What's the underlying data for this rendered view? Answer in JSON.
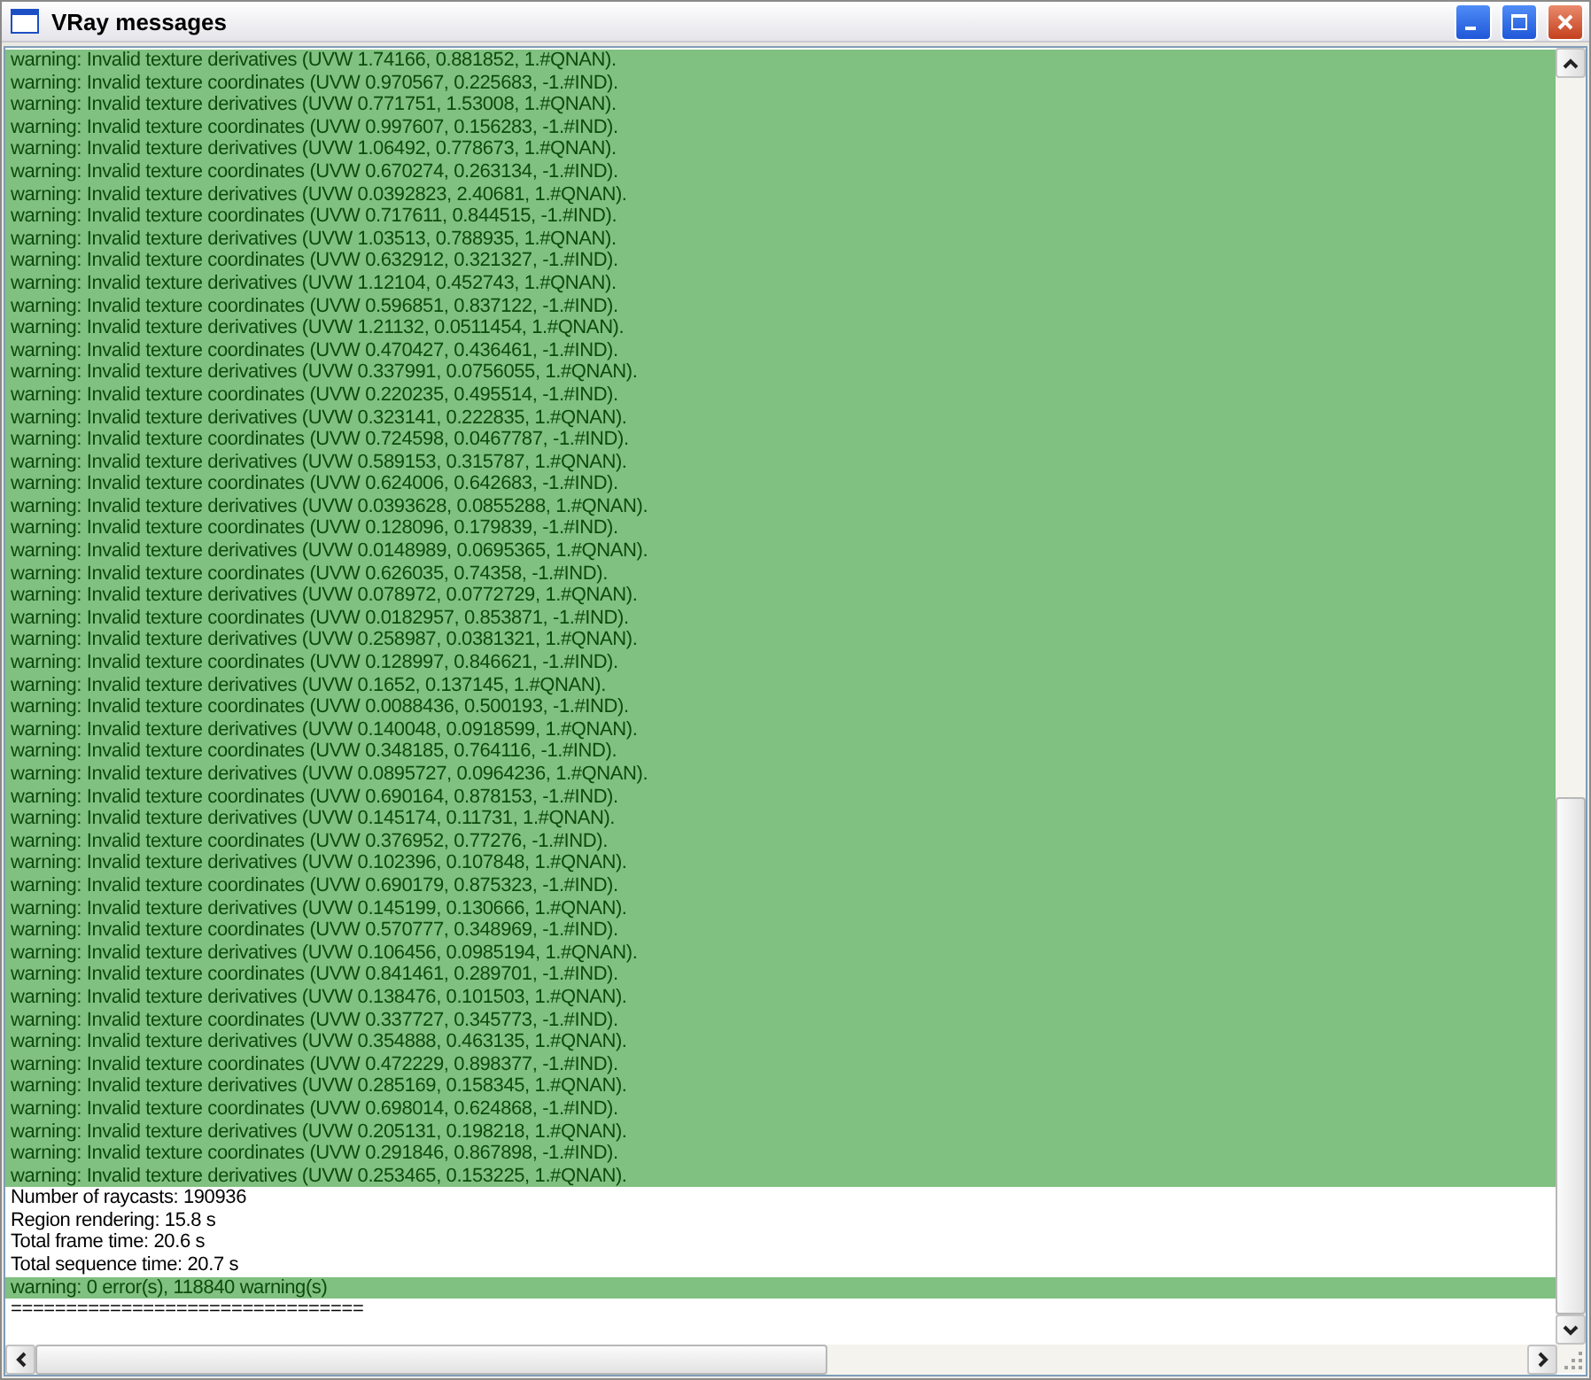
{
  "window": {
    "title": "VRay messages"
  },
  "messages": [
    {
      "kind": "warning",
      "text": "warning: Invalid texture derivatives (UVW 1.74166, 0.881852, 1.#QNAN)."
    },
    {
      "kind": "warning",
      "text": "warning: Invalid texture coordinates (UVW 0.970567, 0.225683, -1.#IND)."
    },
    {
      "kind": "warning",
      "text": "warning: Invalid texture derivatives (UVW 0.771751, 1.53008, 1.#QNAN)."
    },
    {
      "kind": "warning",
      "text": "warning: Invalid texture coordinates (UVW 0.997607, 0.156283, -1.#IND)."
    },
    {
      "kind": "warning",
      "text": "warning: Invalid texture derivatives (UVW 1.06492, 0.778673, 1.#QNAN)."
    },
    {
      "kind": "warning",
      "text": "warning: Invalid texture coordinates (UVW 0.670274, 0.263134, -1.#IND)."
    },
    {
      "kind": "warning",
      "text": "warning: Invalid texture derivatives (UVW 0.0392823, 2.40681, 1.#QNAN)."
    },
    {
      "kind": "warning",
      "text": "warning: Invalid texture coordinates (UVW 0.717611, 0.844515, -1.#IND)."
    },
    {
      "kind": "warning",
      "text": "warning: Invalid texture derivatives (UVW 1.03513, 0.788935, 1.#QNAN)."
    },
    {
      "kind": "warning",
      "text": "warning: Invalid texture coordinates (UVW 0.632912, 0.321327, -1.#IND)."
    },
    {
      "kind": "warning",
      "text": "warning: Invalid texture derivatives (UVW 1.12104, 0.452743, 1.#QNAN)."
    },
    {
      "kind": "warning",
      "text": "warning: Invalid texture coordinates (UVW 0.596851, 0.837122, -1.#IND)."
    },
    {
      "kind": "warning",
      "text": "warning: Invalid texture derivatives (UVW 1.21132, 0.0511454, 1.#QNAN)."
    },
    {
      "kind": "warning",
      "text": "warning: Invalid texture coordinates (UVW 0.470427, 0.436461, -1.#IND)."
    },
    {
      "kind": "warning",
      "text": "warning: Invalid texture derivatives (UVW 0.337991, 0.0756055, 1.#QNAN)."
    },
    {
      "kind": "warning",
      "text": "warning: Invalid texture coordinates (UVW 0.220235, 0.495514, -1.#IND)."
    },
    {
      "kind": "warning",
      "text": "warning: Invalid texture derivatives (UVW 0.323141, 0.222835, 1.#QNAN)."
    },
    {
      "kind": "warning",
      "text": "warning: Invalid texture coordinates (UVW 0.724598, 0.0467787, -1.#IND)."
    },
    {
      "kind": "warning",
      "text": "warning: Invalid texture derivatives (UVW 0.589153, 0.315787, 1.#QNAN)."
    },
    {
      "kind": "warning",
      "text": "warning: Invalid texture coordinates (UVW 0.624006, 0.642683, -1.#IND)."
    },
    {
      "kind": "warning",
      "text": "warning: Invalid texture derivatives (UVW 0.0393628, 0.0855288, 1.#QNAN)."
    },
    {
      "kind": "warning",
      "text": "warning: Invalid texture coordinates (UVW 0.128096, 0.179839, -1.#IND)."
    },
    {
      "kind": "warning",
      "text": "warning: Invalid texture derivatives (UVW 0.0148989, 0.0695365, 1.#QNAN)."
    },
    {
      "kind": "warning",
      "text": "warning: Invalid texture coordinates (UVW 0.626035, 0.74358, -1.#IND)."
    },
    {
      "kind": "warning",
      "text": "warning: Invalid texture derivatives (UVW 0.078972, 0.0772729, 1.#QNAN)."
    },
    {
      "kind": "warning",
      "text": "warning: Invalid texture coordinates (UVW 0.0182957, 0.853871, -1.#IND)."
    },
    {
      "kind": "warning",
      "text": "warning: Invalid texture derivatives (UVW 0.258987, 0.0381321, 1.#QNAN)."
    },
    {
      "kind": "warning",
      "text": "warning: Invalid texture coordinates (UVW 0.128997, 0.846621, -1.#IND)."
    },
    {
      "kind": "warning",
      "text": "warning: Invalid texture derivatives (UVW 0.1652, 0.137145, 1.#QNAN)."
    },
    {
      "kind": "warning",
      "text": "warning: Invalid texture coordinates (UVW 0.0088436, 0.500193, -1.#IND)."
    },
    {
      "kind": "warning",
      "text": "warning: Invalid texture derivatives (UVW 0.140048, 0.0918599, 1.#QNAN)."
    },
    {
      "kind": "warning",
      "text": "warning: Invalid texture coordinates (UVW 0.348185, 0.764116, -1.#IND)."
    },
    {
      "kind": "warning",
      "text": "warning: Invalid texture derivatives (UVW 0.0895727, 0.0964236, 1.#QNAN)."
    },
    {
      "kind": "warning",
      "text": "warning: Invalid texture coordinates (UVW 0.690164, 0.878153, -1.#IND)."
    },
    {
      "kind": "warning",
      "text": "warning: Invalid texture derivatives (UVW 0.145174, 0.11731, 1.#QNAN)."
    },
    {
      "kind": "warning",
      "text": "warning: Invalid texture coordinates (UVW 0.376952, 0.77276, -1.#IND)."
    },
    {
      "kind": "warning",
      "text": "warning: Invalid texture derivatives (UVW 0.102396, 0.107848, 1.#QNAN)."
    },
    {
      "kind": "warning",
      "text": "warning: Invalid texture coordinates (UVW 0.690179, 0.875323, -1.#IND)."
    },
    {
      "kind": "warning",
      "text": "warning: Invalid texture derivatives (UVW 0.145199, 0.130666, 1.#QNAN)."
    },
    {
      "kind": "warning",
      "text": "warning: Invalid texture coordinates (UVW 0.570777, 0.348969, -1.#IND)."
    },
    {
      "kind": "warning",
      "text": "warning: Invalid texture derivatives (UVW 0.106456, 0.0985194, 1.#QNAN)."
    },
    {
      "kind": "warning",
      "text": "warning: Invalid texture coordinates (UVW 0.841461, 0.289701, -1.#IND)."
    },
    {
      "kind": "warning",
      "text": "warning: Invalid texture derivatives (UVW 0.138476, 0.101503, 1.#QNAN)."
    },
    {
      "kind": "warning",
      "text": "warning: Invalid texture coordinates (UVW 0.337727, 0.345773, -1.#IND)."
    },
    {
      "kind": "warning",
      "text": "warning: Invalid texture derivatives (UVW 0.354888, 0.463135, 1.#QNAN)."
    },
    {
      "kind": "warning",
      "text": "warning: Invalid texture coordinates (UVW 0.472229, 0.898377, -1.#IND)."
    },
    {
      "kind": "warning",
      "text": "warning: Invalid texture derivatives (UVW 0.285169, 0.158345, 1.#QNAN)."
    },
    {
      "kind": "warning",
      "text": "warning: Invalid texture coordinates (UVW 0.698014, 0.624868, -1.#IND)."
    },
    {
      "kind": "warning",
      "text": "warning: Invalid texture derivatives (UVW 0.205131, 0.198218, 1.#QNAN)."
    },
    {
      "kind": "warning",
      "text": "warning: Invalid texture coordinates (UVW 0.291846, 0.867898, -1.#IND)."
    },
    {
      "kind": "warning",
      "text": "warning: Invalid texture derivatives (UVW 0.253465, 0.153225, 1.#QNAN)."
    },
    {
      "kind": "info",
      "text": "Number of raycasts: 190936"
    },
    {
      "kind": "info",
      "text": "Region rendering: 15.8 s"
    },
    {
      "kind": "info",
      "text": "Total frame time: 20.6 s"
    },
    {
      "kind": "info",
      "text": "Total sequence time: 20.7 s"
    },
    {
      "kind": "warning",
      "text": "warning: 0 error(s), 118840 warning(s)"
    },
    {
      "kind": "info",
      "text": "================================"
    }
  ]
}
